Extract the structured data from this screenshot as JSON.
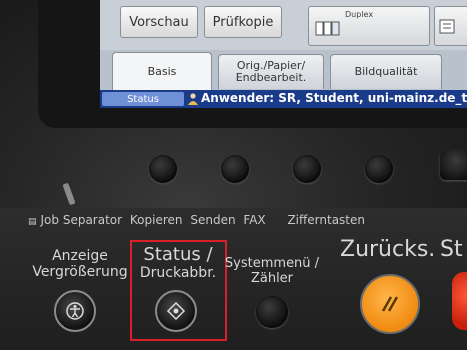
{
  "screen": {
    "buttons": {
      "vorschau": "Vorschau",
      "pruefkopie": "Prüfkopie",
      "duplex": "Duplex"
    },
    "tabs": [
      {
        "label": "Basis"
      },
      {
        "line1": "Orig./Papier/",
        "line2": "Endbearbeit."
      },
      {
        "label": "Bildqualität"
      }
    ],
    "status_bar": {
      "status": "Status",
      "user": "Anwender: SR, Student, uni-mainz.de_testo"
    }
  },
  "panel": {
    "modes": {
      "job_separator": "Job Separator",
      "kopieren": "Kopieren",
      "senden": "Senden",
      "fax": "FAX",
      "zifferntasten": "Zifferntasten"
    },
    "anzeige": {
      "line1": "Anzeige",
      "line2": "Vergrößerung"
    },
    "status_key": {
      "line1": "Status /",
      "line2": "Druckabbr."
    },
    "systemmenu": {
      "line1": "Systemmenü /",
      "line2": "Zähler"
    },
    "zuruecks": "Zurücks.",
    "start_partial": "St"
  },
  "colors": {
    "status_bar": "#1a3a8a",
    "highlight": "#d8202a",
    "reset_key": "#f08a10"
  }
}
